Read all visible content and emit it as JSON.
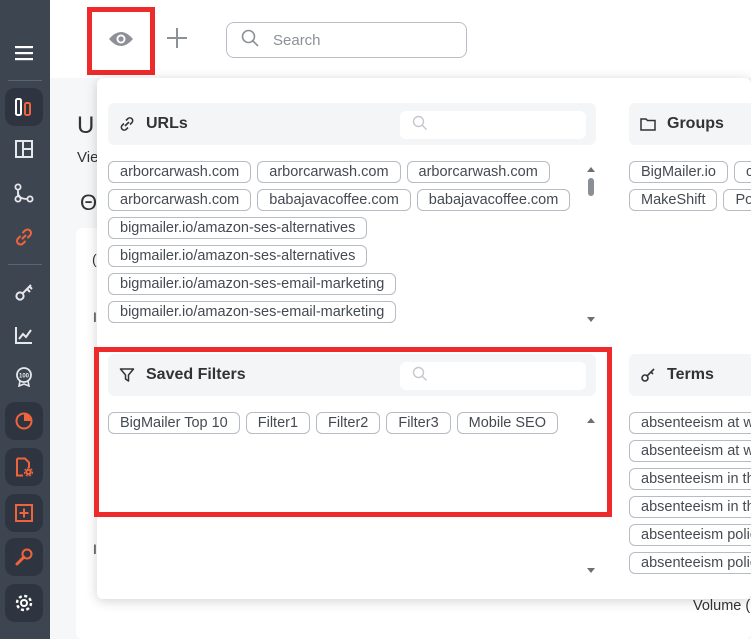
{
  "topbar": {
    "search_placeholder": "Search"
  },
  "background": {
    "letter1": "U",
    "letter2": "Vie",
    "letter3": "Θ",
    "letter4": "(",
    "letter5": "I",
    "letter6": "I",
    "volume_label": "Volume ("
  },
  "sidebar": {
    "items": [
      {
        "icon": "menu-icon"
      },
      {
        "icon": "bars-brand-icon"
      },
      {
        "icon": "layout-icon"
      },
      {
        "icon": "nodes-icon"
      },
      {
        "icon": "link-icon"
      },
      {
        "icon": "key-icon"
      },
      {
        "icon": "chart-line-icon"
      },
      {
        "icon": "badge-100-icon"
      },
      {
        "icon": "pie-chart-icon"
      },
      {
        "icon": "file-gear-icon"
      },
      {
        "icon": "plus-square-icon"
      },
      {
        "icon": "wrench-icon"
      },
      {
        "icon": "settings-icon"
      }
    ]
  },
  "sections": {
    "urls": {
      "title": "URLs",
      "chips": [
        "arborcarwash.com",
        "arborcarwash.com",
        "arborcarwash.com",
        "arborcarwash.com",
        "babajavacoffee.com",
        "babajavacoffee.com",
        "bigmailer.io/amazon-ses-alternatives",
        "bigmailer.io/amazon-ses-alternatives",
        "bigmailer.io/amazon-ses-email-marketing",
        "bigmailer.io/amazon-ses-email-marketing"
      ]
    },
    "groups": {
      "title": "Groups",
      "chips": [
        "BigMailer.io",
        "c",
        "MakeShift",
        "Po"
      ]
    },
    "saved_filters": {
      "title": "Saved Filters",
      "chips": [
        "BigMailer Top 10",
        "Filter1",
        "Filter2",
        "Filter3",
        "Mobile SEO"
      ]
    },
    "terms": {
      "title": "Terms",
      "chips": [
        "absenteeism at w",
        "absenteeism at w",
        "absenteeism in th",
        "absenteeism in th",
        "absenteeism polic",
        "absenteeism polic"
      ]
    }
  },
  "colors": {
    "sidebar_bg": "#3d4551",
    "accent_orange": "#f0643c",
    "highlight_red": "#ee2a2a"
  }
}
